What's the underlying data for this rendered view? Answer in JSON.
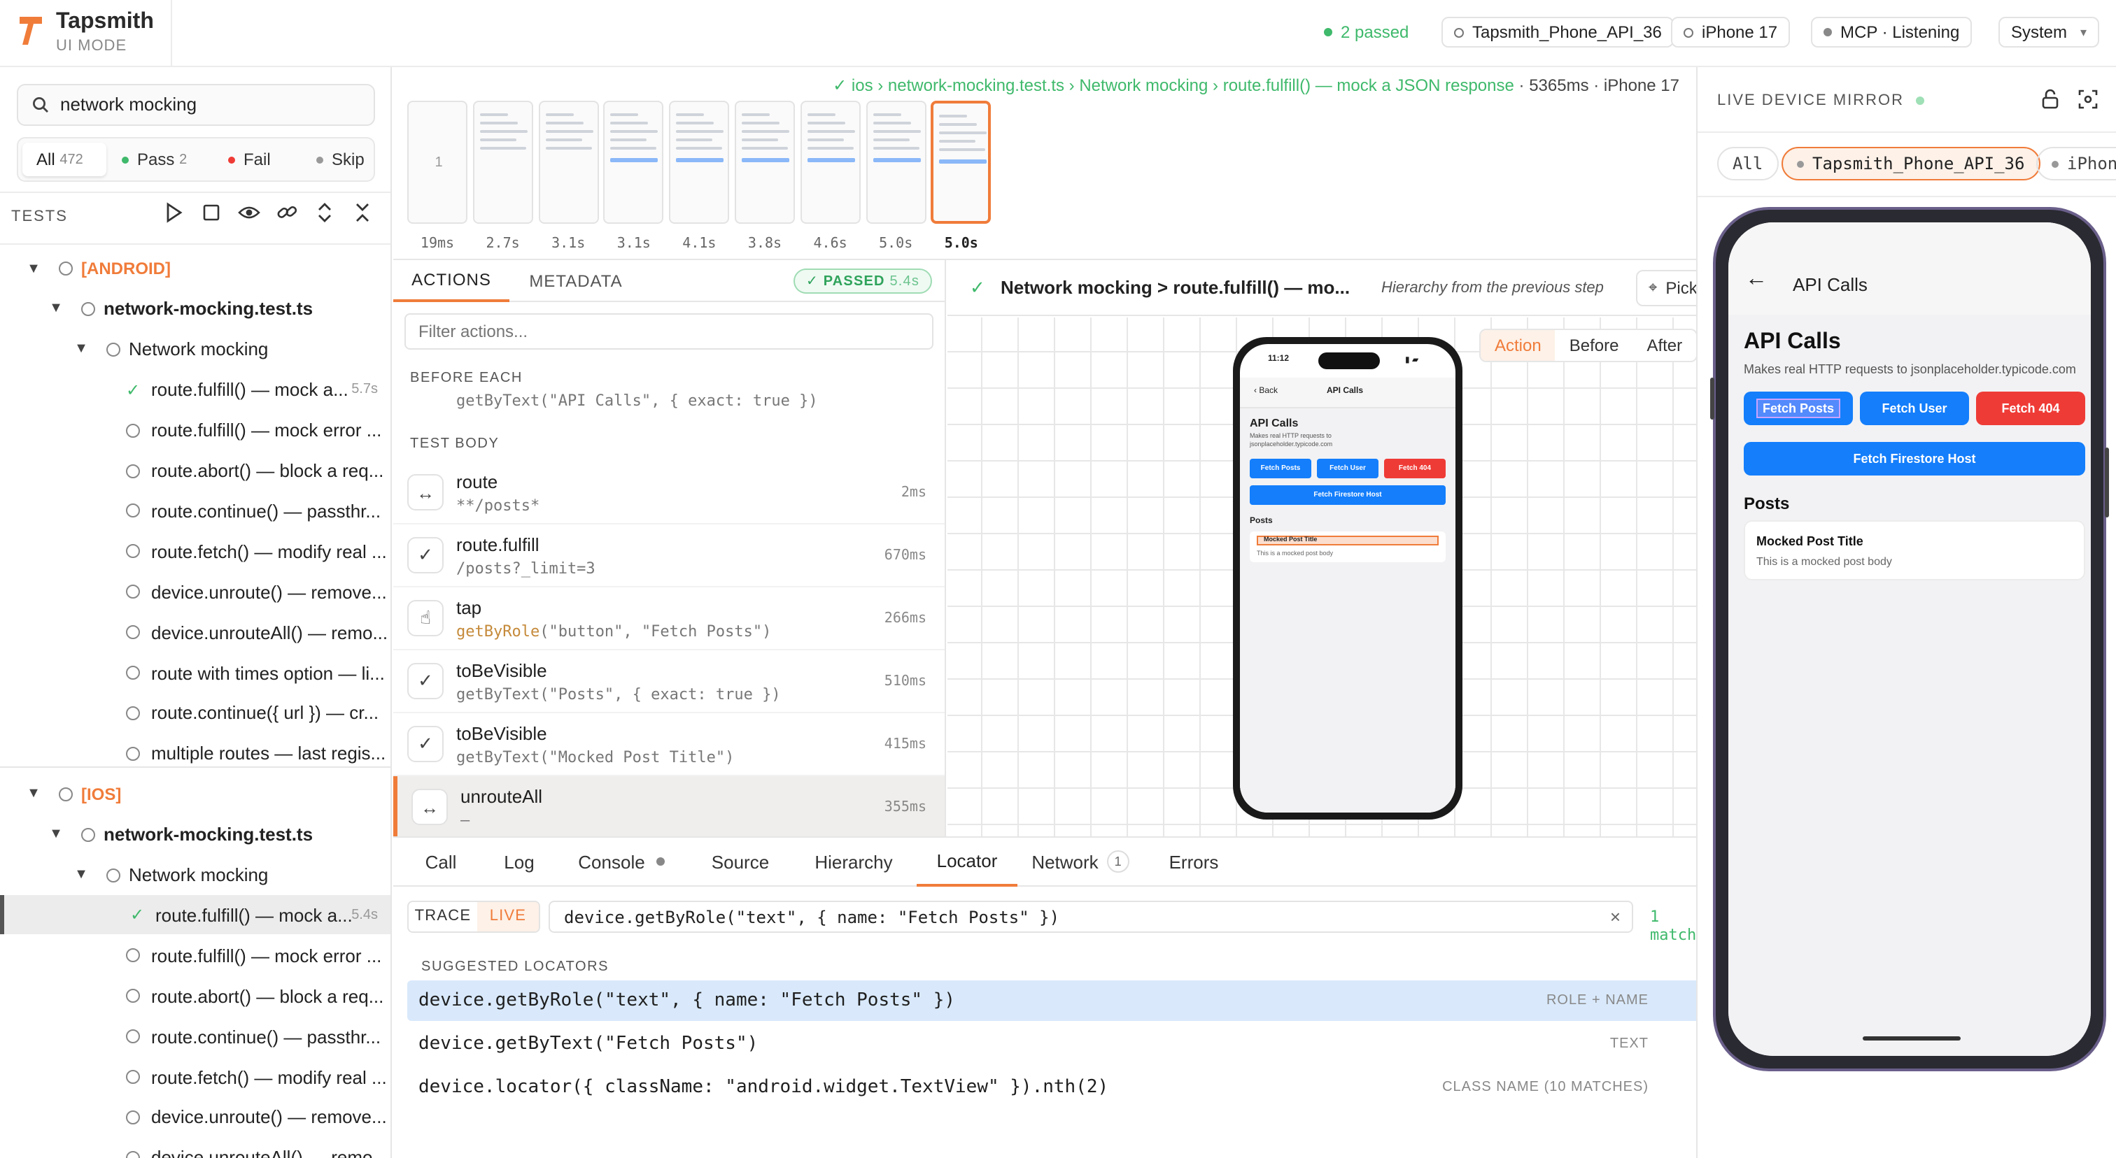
{
  "header": {
    "app_name": "Tapsmith",
    "mode": "UI MODE",
    "passed": "2 passed",
    "device1": "Tapsmith_Phone_API_36",
    "device2": "iPhone 17",
    "mcp": "MCP · Listening",
    "theme": "System",
    "colors": {
      "accent": "#f07c3a",
      "green": "#3fb96b",
      "blue": "#147efb",
      "red": "#ef3b36"
    }
  },
  "sidebar": {
    "search_value": "network mocking",
    "filters": [
      {
        "label": "All",
        "count": "472"
      },
      {
        "label": "Pass",
        "count": "2"
      },
      {
        "label": "Fail",
        "count": ""
      },
      {
        "label": "Skip",
        "count": ""
      }
    ],
    "tests_heading": "TESTS",
    "toolbar_icons": [
      "play-icon",
      "stop-icon",
      "eye-icon",
      "link-icon",
      "expand-icon",
      "collapse-icon"
    ],
    "tree": [
      {
        "type": "project",
        "label": "[ANDROID]"
      },
      {
        "type": "file",
        "label": "network-mocking.test.ts"
      },
      {
        "type": "suite",
        "label": "Network mocking"
      },
      {
        "type": "test",
        "label": "route.fulfill() — mock a...",
        "status": "pass",
        "duration": "5.7s"
      },
      {
        "type": "test",
        "label": "route.fulfill() — mock error ...",
        "status": "none",
        "duration": ""
      },
      {
        "type": "test",
        "label": "route.abort() — block a req...",
        "status": "none",
        "duration": ""
      },
      {
        "type": "test",
        "label": "route.continue() — passthr...",
        "status": "none",
        "duration": ""
      },
      {
        "type": "test",
        "label": "route.fetch() — modify real ...",
        "status": "none",
        "duration": ""
      },
      {
        "type": "test",
        "label": "device.unroute() — remove...",
        "status": "none",
        "duration": ""
      },
      {
        "type": "test",
        "label": "device.unrouteAll() — remo...",
        "status": "none",
        "duration": ""
      },
      {
        "type": "test",
        "label": "route with times option — li...",
        "status": "none",
        "duration": ""
      },
      {
        "type": "test",
        "label": "route.continue({ url }) — cr...",
        "status": "none",
        "duration": ""
      },
      {
        "type": "test",
        "label": "multiple routes — last regis...",
        "status": "none",
        "duration": ""
      },
      {
        "type": "project",
        "label": "[IOS]"
      },
      {
        "type": "file",
        "label": "network-mocking.test.ts"
      },
      {
        "type": "suite",
        "label": "Network mocking"
      },
      {
        "type": "test",
        "label": "route.fulfill() — mock a...",
        "status": "pass",
        "duration": "5.4s"
      },
      {
        "type": "test",
        "label": "route.fulfill() — mock error ...",
        "status": "none",
        "duration": ""
      },
      {
        "type": "test",
        "label": "route.abort() — block a req...",
        "status": "none",
        "duration": ""
      },
      {
        "type": "test",
        "label": "route.continue() — passthr...",
        "status": "none",
        "duration": ""
      },
      {
        "type": "test",
        "label": "route.fetch() — modify real ...",
        "status": "none",
        "duration": ""
      },
      {
        "type": "test",
        "label": "device.unroute() — remove...",
        "status": "none",
        "duration": ""
      },
      {
        "type": "test",
        "label": "device.unrouteAll() — remo...",
        "status": "none",
        "duration": ""
      }
    ]
  },
  "trace": {
    "breadcrumb": "✓ ios › network-mocking.test.ts › Network mocking › route.fulfill() — mock a JSON response",
    "meta": "· 5365ms · iPhone 17",
    "timeline": [
      "19ms",
      "2.7s",
      "3.1s",
      "3.1s",
      "4.1s",
      "3.8s",
      "4.6s",
      "5.0s",
      "5.0s"
    ],
    "first_thumb_label": "1"
  },
  "actions_panel": {
    "tabs": [
      "ACTIONS",
      "METADATA"
    ],
    "status": "PASSED",
    "status_time": "5.4s",
    "filter_placeholder": "Filter actions...",
    "before_each": "BEFORE EACH",
    "before_each_partial": "getByText(\"API Calls\", { exact: true })",
    "test_body": "TEST BODY",
    "actions": [
      {
        "icon": "route-icon",
        "glyph": "↔",
        "name": "route",
        "selector_fn": "",
        "selector": "**/posts*",
        "time": "2ms"
      },
      {
        "icon": "check-icon",
        "glyph": "✓",
        "name": "route.fulfill",
        "selector_fn": "",
        "selector": "/posts?_limit=3",
        "time": "670ms"
      },
      {
        "icon": "tap-icon",
        "glyph": "☝",
        "name": "tap",
        "selector_fn": "getByRole",
        "selector": "(\"button\", \"Fetch Posts\")",
        "time": "266ms"
      },
      {
        "icon": "check-icon",
        "glyph": "✓",
        "name": "toBeVisible",
        "selector_fn": "",
        "selector": "getByText(\"Posts\", { exact: true })",
        "time": "510ms"
      },
      {
        "icon": "check-icon",
        "glyph": "✓",
        "name": "toBeVisible",
        "selector_fn": "",
        "selector": "getByText(\"Mocked Post Title\")",
        "time": "415ms"
      },
      {
        "icon": "route-icon",
        "glyph": "↔",
        "name": "unrouteAll",
        "selector_fn": "",
        "selector": "—",
        "time": "355ms"
      }
    ]
  },
  "snapshot": {
    "title": "Network mocking > route.fulfill() — mo...",
    "hint": "Hierarchy from the previous step",
    "pick": "Pick",
    "modes": [
      "Action",
      "Before",
      "After"
    ],
    "phone": {
      "time": "11:12",
      "back": "Back",
      "nav_title": "API Calls",
      "heading": "API Calls",
      "desc": "Makes real HTTP requests to jsonplaceholder.typicode.com",
      "btn_posts": "Fetch Posts",
      "btn_user": "Fetch User",
      "btn_404": "Fetch 404",
      "btn_firestore": "Fetch Firestore Host",
      "posts_heading": "Posts",
      "post_title": "Mocked Post Title",
      "post_body": "This is a mocked post body"
    }
  },
  "bottom": {
    "tabs": [
      "Call",
      "Log",
      "Console",
      "Source",
      "Hierarchy",
      "Locator",
      "Network",
      "Errors"
    ],
    "network_count": "1",
    "toggle": [
      "TRACE",
      "LIVE"
    ],
    "locator_value": "device.getByRole(\"text\", { name: \"Fetch Posts\" })",
    "match": "1 match",
    "suggested_heading": "SUGGESTED LOCATORS",
    "suggestions": [
      {
        "code": "device.getByRole(\"text\", { name: \"Fetch Posts\" })",
        "tag": "ROLE + NAME"
      },
      {
        "code": "device.getByText(\"Fetch Posts\")",
        "tag": "TEXT"
      },
      {
        "code": "device.locator({ className: \"android.widget.TextView\" }).nth(2)",
        "tag": "CLASS NAME (10 MATCHES)"
      }
    ]
  },
  "mirror": {
    "heading": "LIVE DEVICE MIRROR",
    "tabs": [
      "All",
      "Tapsmith_Phone_API_36",
      "iPhone"
    ],
    "screen": {
      "nav_title": "API Calls",
      "heading": "API Calls",
      "desc": "Makes real HTTP requests to jsonplaceholder.typicode.com",
      "btn_posts": "Fetch Posts",
      "btn_user": "Fetch User",
      "btn_404": "Fetch 404",
      "btn_firestore": "Fetch Firestore Host",
      "posts_heading": "Posts",
      "post_title": "Mocked Post Title",
      "post_body": "This is a mocked post body"
    }
  }
}
